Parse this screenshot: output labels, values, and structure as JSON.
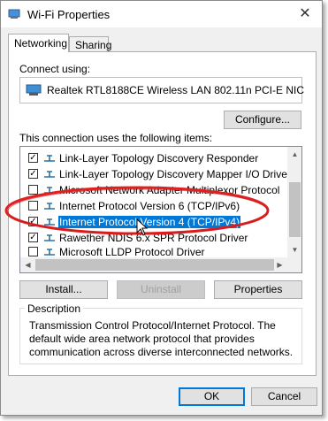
{
  "window": {
    "title": "Wi-Fi Properties",
    "close_glyph": "✕"
  },
  "tabs": [
    {
      "label": "Networking",
      "selected": true
    },
    {
      "label": "Sharing",
      "selected": false
    }
  ],
  "networking": {
    "connect_using_label": "Connect using:",
    "adapter_name": "Realtek RTL8188CE Wireless LAN 802.11n PCI-E NIC",
    "adapter_icon": "network-adapter-icon",
    "configure_label": "Configure...",
    "items_label": "This connection uses the following items:",
    "items": [
      {
        "label": "Link-Layer Topology Discovery Responder",
        "checked": true,
        "icon": "protocol-icon"
      },
      {
        "label": "Link-Layer Topology Discovery Mapper I/O Driver",
        "checked": true,
        "icon": "protocol-icon"
      },
      {
        "label": "Microsoft Network Adapter Multiplexor Protocol",
        "checked": false,
        "icon": "protocol-icon"
      },
      {
        "label": "Internet Protocol Version 6 (TCP/IPv6)",
        "checked": false,
        "icon": "protocol-icon"
      },
      {
        "label": "Internet Protocol Version 4 (TCP/IPv4)",
        "checked": true,
        "selected": true,
        "icon": "protocol-icon"
      },
      {
        "label": "Rawether NDIS 6.x SPR Protocol Driver",
        "checked": true,
        "icon": "protocol-icon"
      },
      {
        "label": "Microsoft LLDP Protocol Driver",
        "checked": false,
        "icon": "protocol-icon"
      }
    ],
    "checkmark": "✓",
    "install_label": "Install...",
    "uninstall_label": "Uninstall",
    "properties_label": "Properties",
    "description_title": "Description",
    "description_text": "Transmission Control Protocol/Internet Protocol. The default wide area network protocol that provides communication across diverse interconnected networks."
  },
  "footer": {
    "ok_label": "OK",
    "cancel_label": "Cancel"
  },
  "colors": {
    "accent": "#0078d7",
    "highlight_ellipse": "#e02020"
  }
}
